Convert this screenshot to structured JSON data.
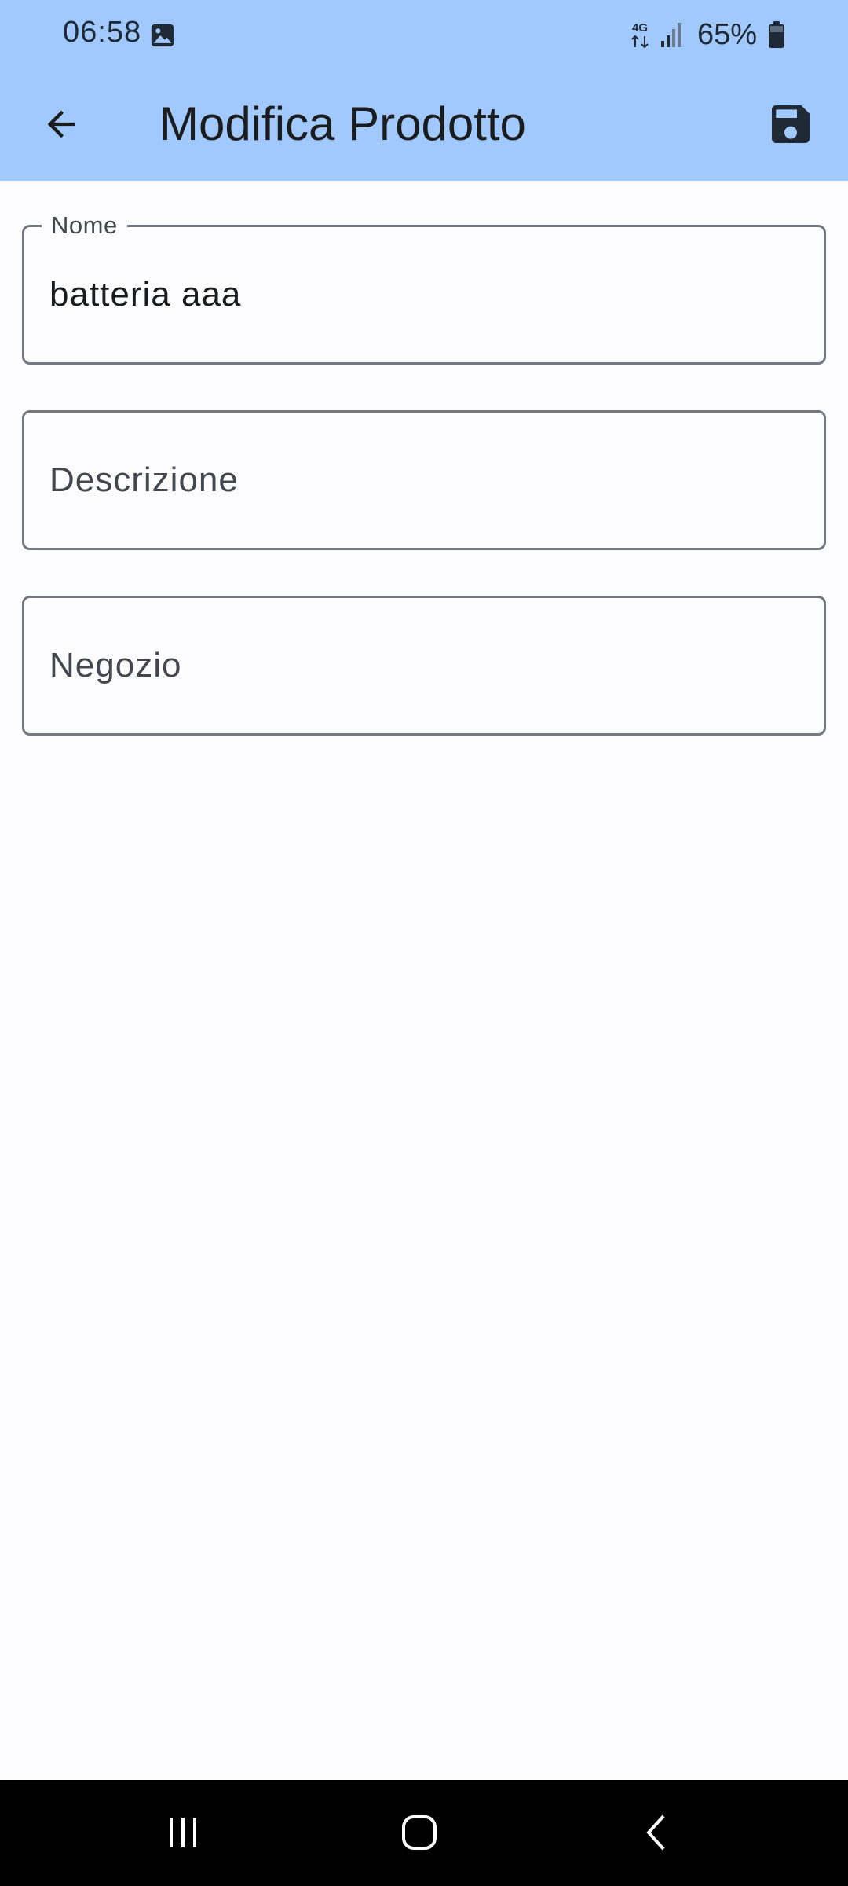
{
  "status_bar": {
    "time": "06:58",
    "network": "4G",
    "battery_percent": "65%",
    "icons": [
      "gallery-icon",
      "network-4g-icon",
      "signal-icon",
      "battery-icon"
    ]
  },
  "app_bar": {
    "title": "Modifica Prodotto",
    "back_icon": "arrow-back-icon",
    "save_icon": "save-icon"
  },
  "form": {
    "nome": {
      "label": "Nome",
      "value": "batteria aaa"
    },
    "descrizione": {
      "placeholder": "Descrizione",
      "value": ""
    },
    "negozio": {
      "placeholder": "Negozio",
      "value": ""
    }
  },
  "nav_bar": {
    "icons": [
      "recents-icon",
      "home-icon",
      "back-icon"
    ]
  },
  "colors": {
    "app_bar": "#a1c9fd",
    "background": "#fcfcff",
    "outline": "#74777f",
    "text": "#1a1c1e",
    "nav_bar": "#000000"
  }
}
